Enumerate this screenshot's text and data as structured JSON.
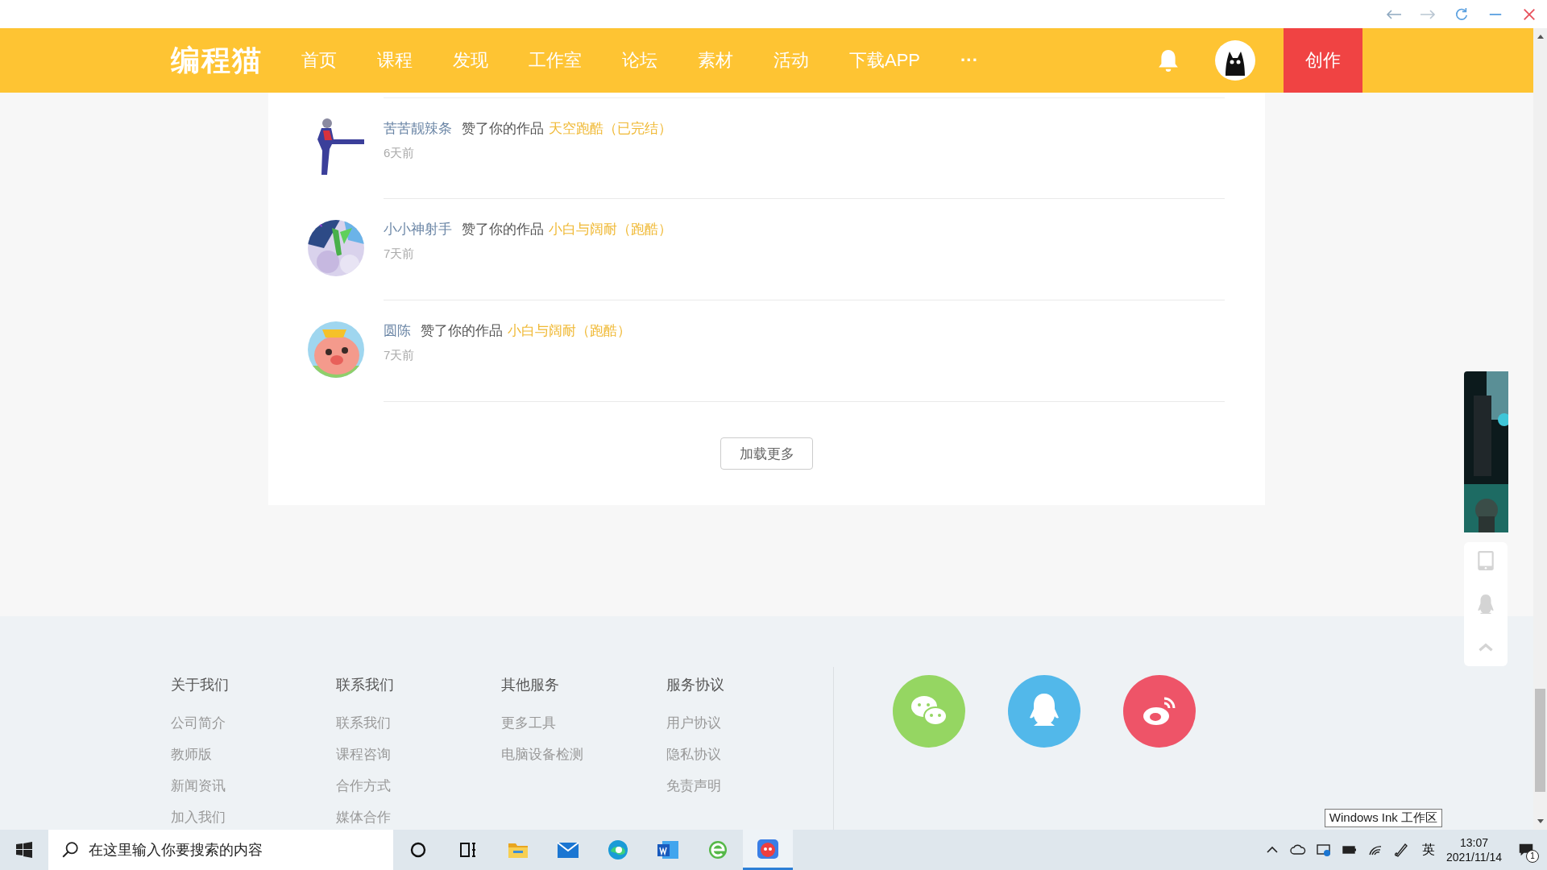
{
  "nav": {
    "logo": "编程猫",
    "items": [
      "首页",
      "课程",
      "发现",
      "工作室",
      "论坛",
      "素材",
      "活动",
      "下载APP"
    ],
    "more": "···",
    "create": "创作"
  },
  "notifications": {
    "items": [
      {
        "user": "苦苦靓辣条",
        "action": "赞了你的作品",
        "work": "天空跑酷（已完结）",
        "time": "6天前",
        "kind": "picture"
      },
      {
        "user": "小小神射手",
        "action": "赞了你的作品",
        "work": "小白与阔耐（跑酷）",
        "time": "7天前",
        "kind": "picture"
      },
      {
        "user": "圆陈",
        "action": "赞了你的作品",
        "work": "小白与阔耐（跑酷）",
        "time": "7天前",
        "kind": "picture"
      }
    ],
    "load_more": "加载更多"
  },
  "footer": {
    "columns": [
      {
        "title": "关于我们",
        "links": [
          "公司简介",
          "教师版",
          "新闻资讯",
          "加入我们"
        ]
      },
      {
        "title": "联系我们",
        "links": [
          "联系我们",
          "课程咨询",
          "合作方式",
          "媒体合作"
        ]
      },
      {
        "title": "其他服务",
        "links": [
          "更多工具",
          "电脑设备检测"
        ]
      },
      {
        "title": "服务协议",
        "links": [
          "用户协议",
          "隐私协议",
          "免责声明"
        ]
      }
    ],
    "social": [
      {
        "kind": "wechat",
        "color": "#95d662"
      },
      {
        "kind": "qq",
        "color": "#52b8ea"
      },
      {
        "kind": "weibo",
        "color": "#ee5468"
      }
    ]
  },
  "taskbar": {
    "search": {
      "placeholder": "在这里输入你要搜索的内容"
    },
    "apps": [
      {
        "kind": "cortana",
        "selected": false
      },
      {
        "kind": "taskview",
        "selected": false
      },
      {
        "kind": "explorer",
        "selected": false
      },
      {
        "kind": "mail",
        "selected": false
      },
      {
        "kind": "edge",
        "selected": false
      },
      {
        "kind": "word",
        "selected": false
      },
      {
        "kind": "ie",
        "selected": false
      },
      {
        "kind": "codemao",
        "selected": true
      }
    ],
    "ime": "英",
    "time": "13:07",
    "date": "2021/11/14",
    "notification_count": "1",
    "tooltip": "Windows Ink 工作区"
  }
}
